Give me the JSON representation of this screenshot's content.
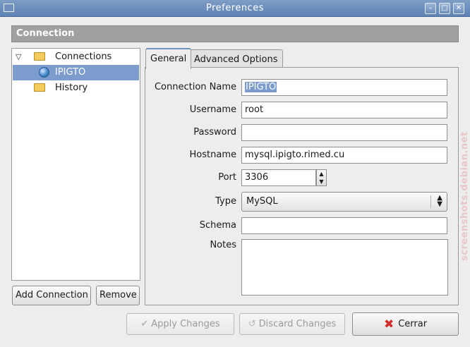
{
  "window": {
    "title": "Preferences",
    "controls": [
      "minimize-icon",
      "maximize-icon",
      "close-icon"
    ]
  },
  "section": {
    "title": "Connection"
  },
  "tree": {
    "items": [
      {
        "label": "Connections",
        "icon": "folder-icon",
        "expanded": true
      },
      {
        "label": "IPIGTO",
        "icon": "network-globe-icon",
        "selected": true
      },
      {
        "label": "History",
        "icon": "folder-icon"
      }
    ]
  },
  "left_buttons": {
    "add": "Add Connection",
    "remove": "Remove"
  },
  "tabs": [
    {
      "label": "General",
      "active": true
    },
    {
      "label": "Advanced Options",
      "active": false
    }
  ],
  "form": {
    "connection_name": {
      "label": "Connection Name",
      "value": "IPIGTO"
    },
    "username": {
      "label": "Username",
      "value": "root"
    },
    "password": {
      "label": "Password",
      "value": ""
    },
    "hostname": {
      "label": "Hostname",
      "value": "mysql.ipigto.rimed.cu"
    },
    "port": {
      "label": "Port",
      "value": "3306"
    },
    "type": {
      "label": "Type",
      "value": "MySQL"
    },
    "schema": {
      "label": "Schema",
      "value": ""
    },
    "notes": {
      "label": "Notes",
      "value": ""
    }
  },
  "bottom_buttons": {
    "apply": "Apply Changes",
    "discard": "Discard Changes",
    "close": "Cerrar"
  },
  "watermark": {
    "text": "screenshots.debian.net"
  },
  "colors": {
    "titlebar": "#6f8fbf",
    "selection": "#7b9ccc",
    "section_header": "#a0a0a0",
    "close_icon": "#d12b2b"
  }
}
